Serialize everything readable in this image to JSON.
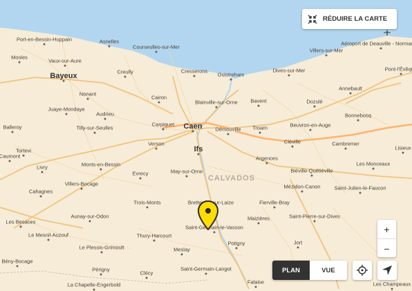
{
  "controls": {
    "reduce_label": "RÉDUIRE LA CARTE",
    "zoom_in": "+",
    "zoom_out": "−",
    "plan_label": "PLAN",
    "vue_label": "VUE"
  },
  "colors": {
    "sea": "#b2d6ef",
    "land": "#f6ecd8",
    "road": "#f2c47c",
    "pin": "#ffdd00"
  },
  "places": [
    {
      "name": "Port-en-Bessin-Huppain"
    },
    {
      "name": "Asnelles"
    },
    {
      "name": "Courseulles-sur-Mer"
    },
    {
      "name": "Mosles"
    },
    {
      "name": "Vaux-sur-Aure"
    },
    {
      "name": "Bayeux"
    },
    {
      "name": "Creully"
    },
    {
      "name": "Cresserons"
    },
    {
      "name": "Ouistreham"
    },
    {
      "name": "Dives-sur-Mer"
    },
    {
      "name": "Villers-sur-Mer"
    },
    {
      "name": "Aéroport de Deauville - Normandie"
    },
    {
      "name": "Pont-l'Évêque"
    },
    {
      "name": "Nonant"
    },
    {
      "name": "Cairon"
    },
    {
      "name": "Blainville-sur-Orne"
    },
    {
      "name": "Bavent"
    },
    {
      "name": "Dozulé"
    },
    {
      "name": "Annebault"
    },
    {
      "name": "Juaye-Mondaye"
    },
    {
      "name": "Audrieu"
    },
    {
      "name": "Bonnebosq"
    },
    {
      "name": "Balleroy"
    },
    {
      "name": "Tilly-sur-Seulles"
    },
    {
      "name": "Carpiquet"
    },
    {
      "name": "Caen"
    },
    {
      "name": "Démouville"
    },
    {
      "name": "Troarn"
    },
    {
      "name": "Beuvron-en-Auge"
    },
    {
      "name": "Tortevi"
    },
    {
      "name": "Verson"
    },
    {
      "name": "Ifs"
    },
    {
      "name": "Cléville"
    },
    {
      "name": "Cambremer"
    },
    {
      "name": "Caumont"
    },
    {
      "name": "Monts-en-Bessin"
    },
    {
      "name": "Argences"
    },
    {
      "name": "Lisieux"
    },
    {
      "name": "Livry"
    },
    {
      "name": "Evrecy"
    },
    {
      "name": "May-sur-Orne"
    },
    {
      "name": "Biéville-Quétiéville"
    },
    {
      "name": "Les Monceaux"
    },
    {
      "name": "Cahagnes"
    },
    {
      "name": "Villers-Bocage"
    },
    {
      "name": "CALVADOS"
    },
    {
      "name": "Mézidon-Canon"
    },
    {
      "name": "Saint-Julien-le-Faucon"
    },
    {
      "name": "Trois-Monts"
    },
    {
      "name": "Bretteville-sur-Laize"
    },
    {
      "name": "Fierville-Bray"
    },
    {
      "name": "Saint-Pierre-sur-Dives"
    },
    {
      "name": "Aunay-sur-Odon"
    },
    {
      "name": "Maizières"
    },
    {
      "name": "Les Besaces"
    },
    {
      "name": "Saint-Germain-le-Vasson"
    },
    {
      "name": "Le Mesnil-Auzouf"
    },
    {
      "name": "Thury-Harcourt"
    },
    {
      "name": "Potigny"
    },
    {
      "name": "Jort"
    },
    {
      "name": "Le Plessis-Grimoult"
    },
    {
      "name": "Meslay"
    },
    {
      "name": "Bény-Bocage"
    },
    {
      "name": "Saint-Germain-Langot"
    },
    {
      "name": "Périgny"
    },
    {
      "name": "Clécy"
    },
    {
      "name": "Falaise"
    },
    {
      "name": "La Chapelle-Engerbold"
    },
    {
      "name": "Les Champeaux"
    }
  ]
}
